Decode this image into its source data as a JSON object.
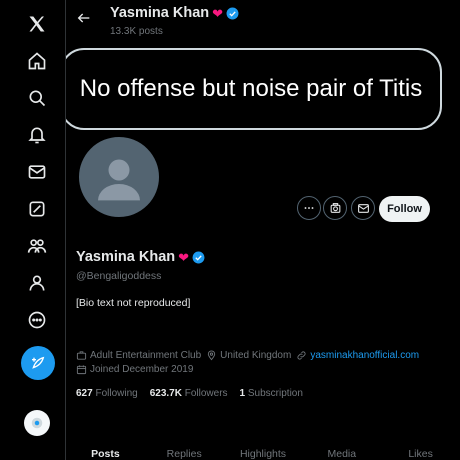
{
  "profile": {
    "display_name": "Yasmina Khan",
    "post_count": "13.3K posts",
    "handle": "@Bengaligoddess",
    "banner_text": "No offense but noise pair of Titis",
    "bio_placeholder": "[Bio text not reproduced]",
    "category": "Adult Entertainment Club",
    "location": "United Kingdom",
    "website": "yasminakhanofficial.com",
    "joined": "Joined December 2019"
  },
  "counts": {
    "following_value": "627",
    "following_label": "Following",
    "followers_value": "623.7K",
    "followers_label": "Followers",
    "subscriptions_value": "1",
    "subscriptions_label": "Subscription"
  },
  "actions": {
    "follow_label": "Follow"
  },
  "tabs": [
    {
      "label": "Posts"
    },
    {
      "label": "Replies"
    },
    {
      "label": "Highlights"
    },
    {
      "label": "Media"
    },
    {
      "label": "Likes"
    }
  ],
  "nav": [
    {
      "icon": "x-logo-icon"
    },
    {
      "icon": "home-icon"
    },
    {
      "icon": "explore-icon"
    },
    {
      "icon": "notifications-icon"
    },
    {
      "icon": "messages-icon"
    },
    {
      "icon": "grok-icon"
    },
    {
      "icon": "communities-icon"
    },
    {
      "icon": "profile-icon"
    },
    {
      "icon": "more-icon"
    }
  ],
  "colors": {
    "accent": "#1d9bf0",
    "background": "#000000",
    "text": "#e7e9ea",
    "muted": "#71767b"
  }
}
